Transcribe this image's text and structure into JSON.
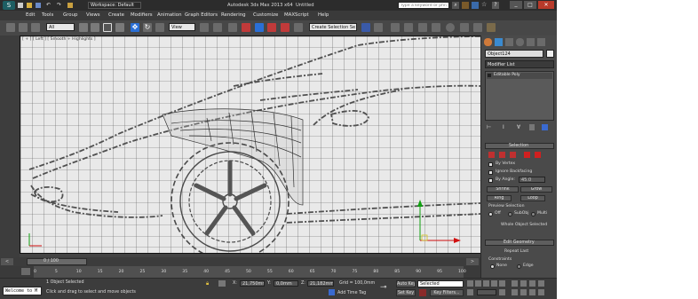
{
  "titlebar": {
    "workspace": "Workspace: Default",
    "title": "Autodesk 3ds Max 2013 x64",
    "filename": "Untitled",
    "search_placeholder": "Type a keyword or phrase"
  },
  "menu": [
    "Edit",
    "Tools",
    "Group",
    "Views",
    "Create",
    "Modifiers",
    "Animation",
    "Graph Editors",
    "Rendering",
    "Customize",
    "MAXScript",
    "Help"
  ],
  "toolbar": {
    "filter": "All",
    "view": "View",
    "selection_set": "Create Selection Se"
  },
  "viewport": {
    "label": "[ + ] [ Left ] [ Smooth + Highlights ]"
  },
  "command_panel": {
    "object_name": "Object124",
    "modifier_list": "Modifier List",
    "stack_item": "Editable Poly",
    "selection": {
      "title": "Selection",
      "by_vertex": "By Vertex",
      "ignore_backfacing": "Ignore Backfacing",
      "by_angle": "By Angle:",
      "angle_value": "45.0",
      "shrink": "Shrink",
      "grow": "Grow",
      "ring": "Ring",
      "loop": "Loop",
      "preview_selection": "Preview Selection",
      "off": "Off",
      "subobj": "SubObj",
      "multi": "Multi",
      "status": "Whole Object Selected"
    },
    "edit_geometry": {
      "title": "Edit Geometry",
      "repeat_last": "Repeat Last",
      "constraints": "Constraints",
      "none": "None",
      "edge": "Edge"
    }
  },
  "timeline": {
    "frame": "0 / 100",
    "ticks": [
      "0",
      "5",
      "10",
      "15",
      "20",
      "25",
      "30",
      "35",
      "40",
      "45",
      "50",
      "55",
      "60",
      "65",
      "70",
      "75",
      "80",
      "85",
      "90",
      "95",
      "100"
    ]
  },
  "status": {
    "maxscript": "Welcome to M",
    "selected": "1 Object Selected",
    "prompt": "Click and drag to select and move objects",
    "x": "21,750mm",
    "y": "0,0mm",
    "z": "21,182mm",
    "grid": "Grid = 100,0mm",
    "add_time_tag": "Add Time Tag",
    "auto_key": "Auto Key",
    "key_mode": "Selected",
    "set_key": "Set Key",
    "key_filters": "Key Filters...",
    "x_label": "X:",
    "y_label": "Y:",
    "z_label": "Z:"
  },
  "colors": {
    "accent_blue": "#2a6fd6",
    "auto_key_red": "#b03030",
    "axis_red": "#d01010",
    "axis_green": "#10a010"
  }
}
